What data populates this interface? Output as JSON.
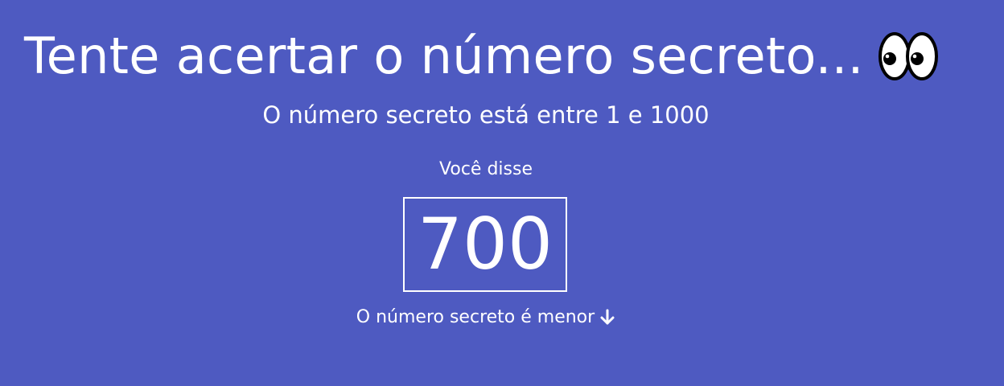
{
  "colors": {
    "background": "#4e5ac1",
    "text": "#ffffff"
  },
  "header": {
    "title": "Tente acertar o número secreto...",
    "title_icon": "eyes-icon"
  },
  "game": {
    "range_text": "O número secreto está entre 1 e 1000",
    "you_said_label": "Você disse",
    "guess_value": "700",
    "hint_text": "O número secreto é menor",
    "hint_icon": "arrow-down-icon"
  }
}
